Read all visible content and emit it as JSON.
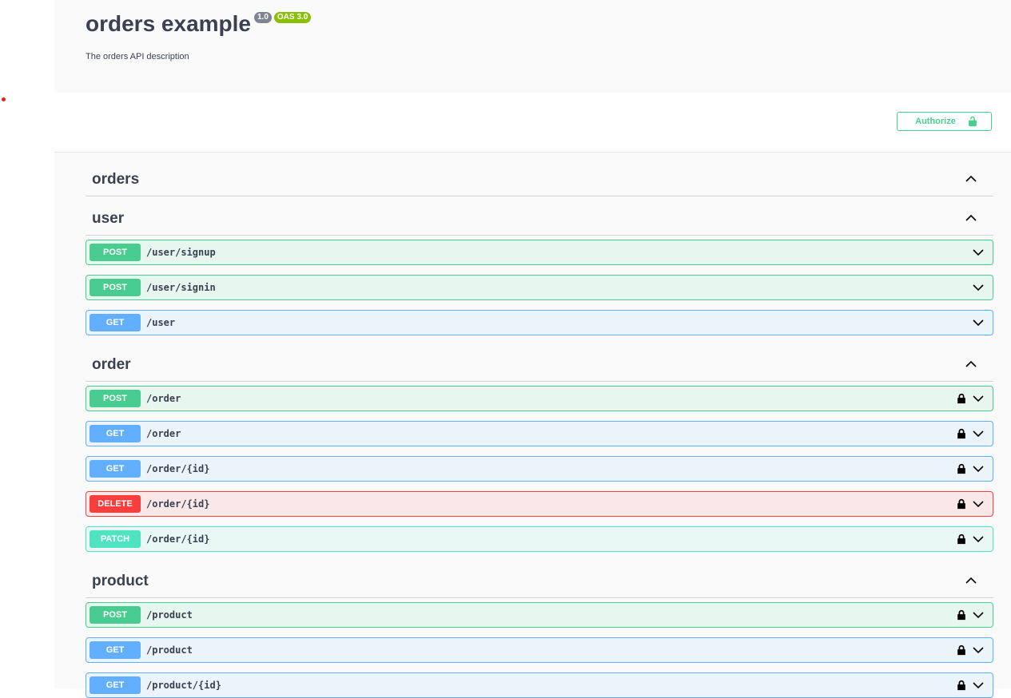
{
  "info": {
    "title": "orders example",
    "version_badge": "1.0",
    "oas_badge": "OAS 3.0",
    "description": "The orders API description"
  },
  "authorize": {
    "label": "Authorize",
    "icon": "unlock-icon"
  },
  "colors": {
    "post": "#49cc90",
    "get": "#61affe",
    "delete": "#f93e3e",
    "patch": "#50e3c2"
  },
  "tags": [
    {
      "name": "orders",
      "operations": []
    },
    {
      "name": "user",
      "operations": [
        {
          "method": "POST",
          "path": "/user/signup",
          "locked": false
        },
        {
          "method": "POST",
          "path": "/user/signin",
          "locked": false
        },
        {
          "method": "GET",
          "path": "/user",
          "locked": false
        }
      ]
    },
    {
      "name": "order",
      "operations": [
        {
          "method": "POST",
          "path": "/order",
          "locked": true
        },
        {
          "method": "GET",
          "path": "/order",
          "locked": true
        },
        {
          "method": "GET",
          "path": "/order/{id}",
          "locked": true
        },
        {
          "method": "DELETE",
          "path": "/order/{id}",
          "locked": true
        },
        {
          "method": "PATCH",
          "path": "/order/{id}",
          "locked": true
        }
      ]
    },
    {
      "name": "product",
      "operations": [
        {
          "method": "POST",
          "path": "/product",
          "locked": true
        },
        {
          "method": "GET",
          "path": "/product",
          "locked": true
        },
        {
          "method": "GET",
          "path": "/product/{id}",
          "locked": true
        }
      ]
    }
  ]
}
